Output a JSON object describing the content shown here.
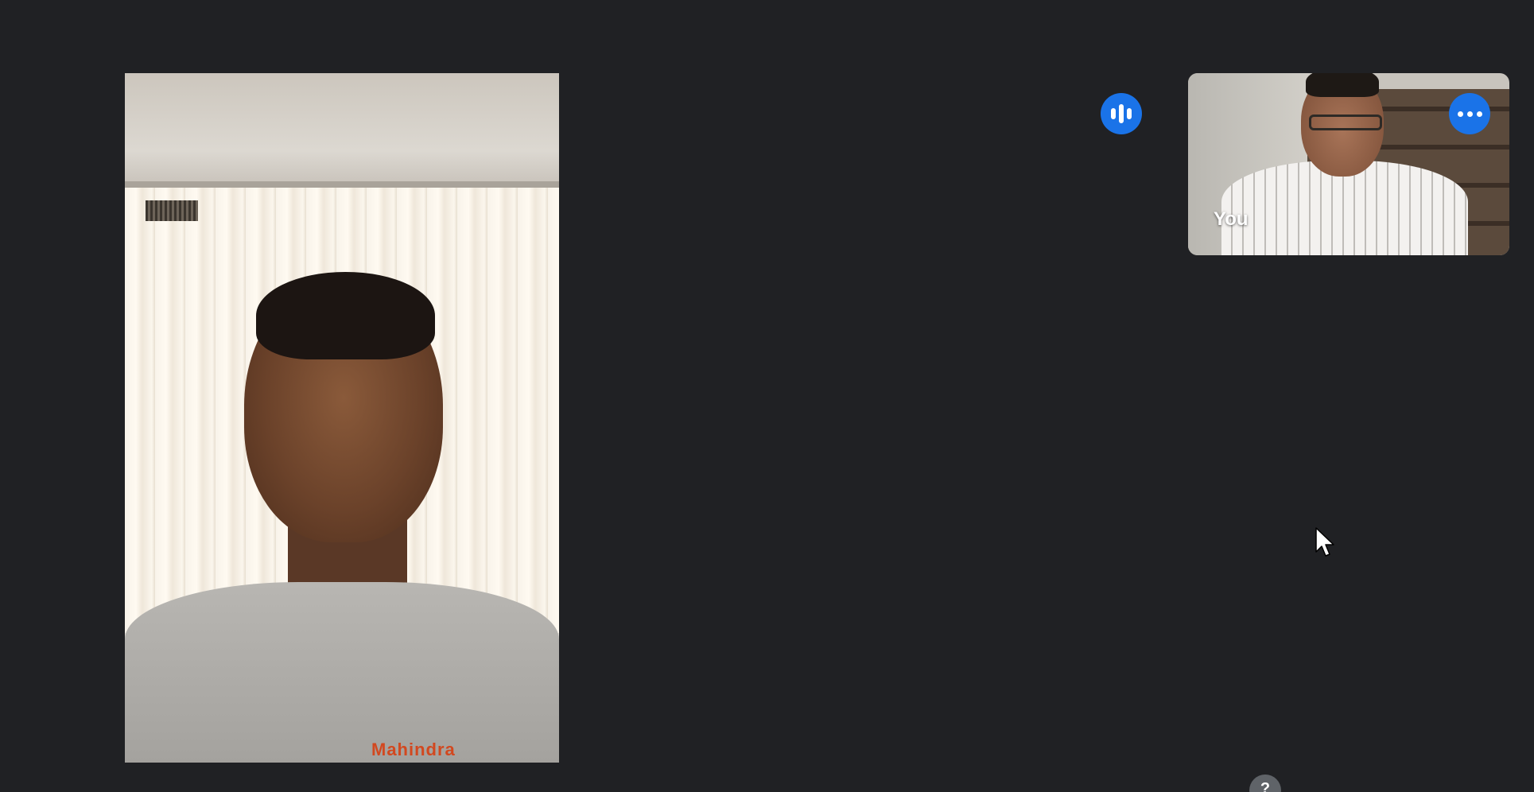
{
  "meeting": {
    "background_color": "#202124",
    "accent_color": "#1a73e8"
  },
  "participants": {
    "main": {
      "shirt_logo": "Mahindra"
    },
    "self": {
      "label": "You"
    }
  },
  "controls": {
    "speaking_indicator_icon": "audio-level-icon",
    "more_options_icon": "more-horiz-icon",
    "help_badge": "?"
  }
}
